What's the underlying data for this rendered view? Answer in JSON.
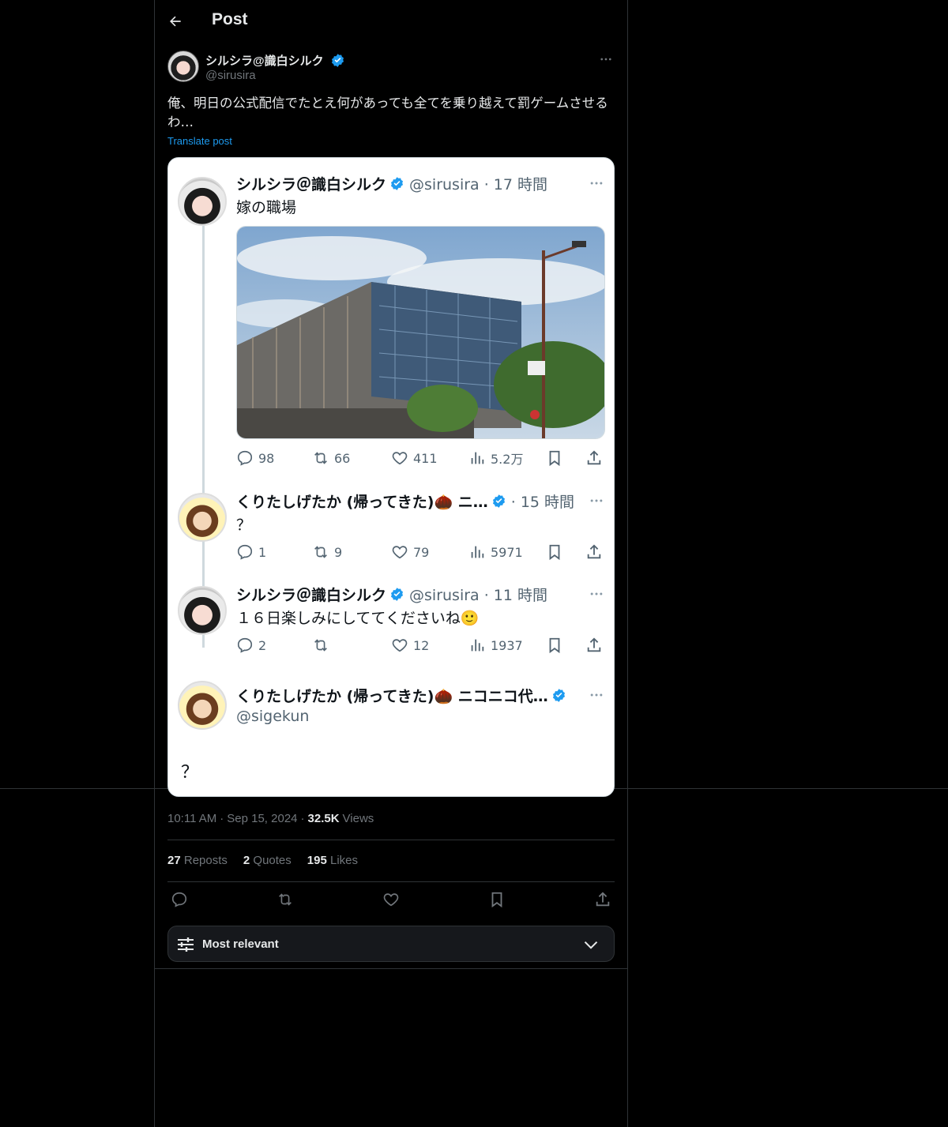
{
  "header": {
    "title": "Post"
  },
  "author": {
    "name": "シルシラ@識白シルク",
    "handle": "@sirusira"
  },
  "post": {
    "text": "俺、明日の公式配信でたとえ何があっても全てを乗り越えて罰ゲームさせるわ…",
    "translate_label": "Translate post"
  },
  "screenshot_card": {
    "tweets": [
      {
        "name": "シルシラ＠識白シルク",
        "meta": "@sirusira · 17 時間",
        "text": "嫁の職場",
        "stats": {
          "replies": "98",
          "reposts": "66",
          "likes": "411",
          "views": "5.2万"
        }
      },
      {
        "name": "くりたしげたか (帰ってきた)🌰 ニ…",
        "meta": "· 15 時間",
        "text": "？",
        "stats": {
          "replies": "1",
          "reposts": "9",
          "likes": "79",
          "views": "5971"
        }
      },
      {
        "name": "シルシラ＠識白シルク",
        "meta": "@sirusira · 11 時間",
        "text": "１６日楽しみにしててくださいね🙂",
        "stats": {
          "replies": "2",
          "reposts": "",
          "likes": "12",
          "views": "1937"
        }
      },
      {
        "name": "くりたしげたか (帰ってきた)🌰 ニコニコ代…",
        "meta": "@sigekun",
        "text": "？"
      }
    ]
  },
  "meta": {
    "time": "10:11 AM",
    "date": "Sep 15, 2024",
    "views_count": "32.5K",
    "views_label": "Views"
  },
  "stats": {
    "reposts_count": "27",
    "reposts_label": "Reposts",
    "quotes_count": "2",
    "quotes_label": "Quotes",
    "likes_count": "195",
    "likes_label": "Likes"
  },
  "sort": {
    "label": "Most relevant"
  },
  "colors": {
    "accent": "#1d9bf0",
    "background": "#000000",
    "muted": "#71767b",
    "border": "#2f3336"
  }
}
